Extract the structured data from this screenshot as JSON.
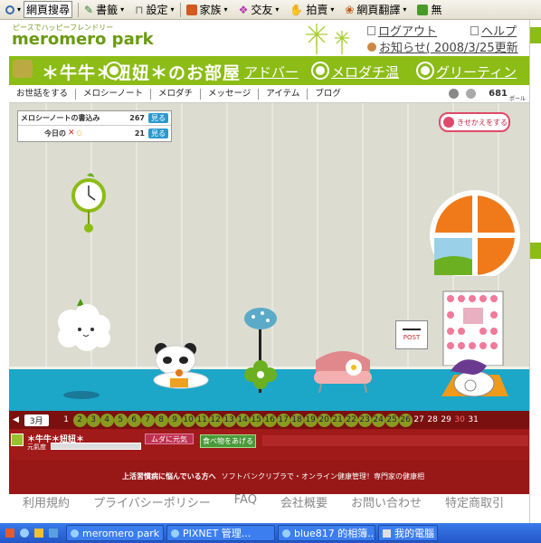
{
  "toolbar": {
    "search_label": "網頁搜尋",
    "bookmarks_label": "書籤",
    "settings_label": "設定",
    "family_label": "家族",
    "friends_label": "交友",
    "auction_label": "拍賣",
    "translate_label": "網頁翻譯",
    "more_label": "無"
  },
  "site": {
    "tagline": "ピースでハッピーフレンドリー",
    "logo": "meromero park",
    "logout": "ログアウト",
    "help": "ヘルプ",
    "notice": "お知らせ( 2008/3/25更新"
  },
  "room": {
    "title": "＊牛牛＊妞妞＊のお部屋",
    "ann1": "アドバー",
    "ann2": "メロダチ温",
    "ann3": "グリーティン"
  },
  "menu": {
    "items": [
      "お世話をする",
      "メロシーノート",
      "メロダチ",
      "メッセージ",
      "アイテム",
      "ブログ"
    ],
    "points": "681",
    "points_unit": "ポール"
  },
  "info": {
    "row1_label": "メロシーノートの書込み",
    "row1_value": "267",
    "row2_label": "今日の",
    "row2_value": "21",
    "see_label": "見る"
  },
  "dressup_label": "きせかえをする",
  "mailbox_label": "POST",
  "calendar": {
    "month": "3月",
    "days": [
      "1",
      "2",
      "3",
      "4",
      "5",
      "6",
      "7",
      "8",
      "9",
      "10",
      "11",
      "12",
      "13",
      "14",
      "15",
      "16",
      "17",
      "18",
      "19",
      "20",
      "21",
      "22",
      "23",
      "24",
      "25",
      "26",
      "27",
      "28",
      "29",
      "30",
      "31"
    ]
  },
  "status": {
    "name": "＊牛牛＊妞妞＊",
    "state": "元氣度",
    "badge": "ムダに元気",
    "feed": "食べ物をあげる"
  },
  "promo": {
    "text1": "上活習慣病に悩んでいる方へ",
    "text2": "ソフトバンクリブラで・オンライン健康管理！専門家の健康相"
  },
  "footer": [
    "利用規約",
    "プライバシーポリシー",
    "FAQ",
    "会社概要",
    "お問い合わせ",
    "特定商取引"
  ],
  "taskbar": [
    "meromero park ...",
    "PIXNET 管理...",
    "blue817 的相簿...",
    "我的電腦"
  ],
  "colors": {
    "green": "#8cbc16",
    "floor": "#1ca6c8",
    "cal": "#7a1010",
    "taskbar": "#2356c8"
  }
}
